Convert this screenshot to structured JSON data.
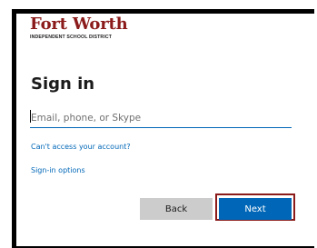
{
  "logo": {
    "title": "Fort Worth",
    "subtitle": "INDEPENDENT SCHOOL DISTRICT"
  },
  "heading": "Sign in",
  "email_input": {
    "placeholder": "Email, phone, or Skype",
    "value": ""
  },
  "links": {
    "cant_access": "Can't access your account?",
    "sign_in_options": "Sign-in options"
  },
  "buttons": {
    "back": "Back",
    "next": "Next"
  },
  "colors": {
    "brand_red": "#8b1a1a",
    "accent_blue": "#0067b8",
    "back_button_gray": "#cccccc"
  }
}
